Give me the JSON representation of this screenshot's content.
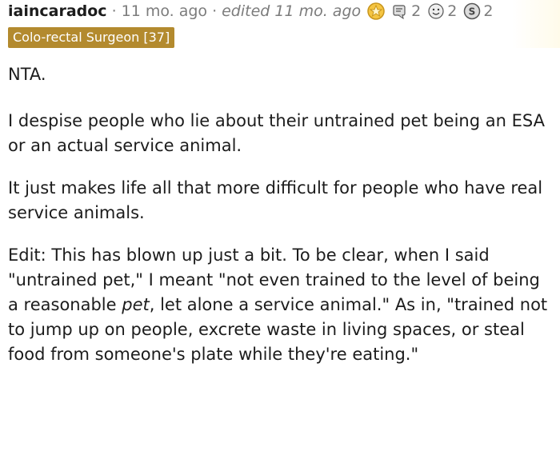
{
  "comment": {
    "username": "iaincaradoc",
    "separator": "·",
    "time": "11 mo. ago",
    "edited": "edited 11 mo. ago",
    "awards": [
      {
        "icon": "gold-award-icon",
        "count": ""
      },
      {
        "icon": "helpful-award-icon",
        "count": "2"
      },
      {
        "icon": "wholesome-award-icon",
        "count": "2"
      },
      {
        "icon": "silver-award-icon",
        "count": "2"
      }
    ],
    "flair": "Colo-rectal Surgeon [37]",
    "paragraphs": {
      "p1": "NTA.",
      "p2": "I despise people who lie about their untrained pet being an ESA or an actual service animal.",
      "p3": "It just makes life all that more difficult for people who have real service animals.",
      "p4_a": "Edit: This has blown up just a bit. To be clear, when I said \"untrained pet,\" I meant \"not even trained to the level of being a reasonable ",
      "p4_em": "pet",
      "p4_b": ", let alone a service animal.\" As in, \"trained not to jump up on people, excrete waste in living spaces, or steal food from someone's plate while they're eating.\""
    }
  },
  "colors": {
    "flair_bg": "#b38a2e",
    "meta_gray": "#7c7c7c",
    "text": "#1c1c1c"
  }
}
